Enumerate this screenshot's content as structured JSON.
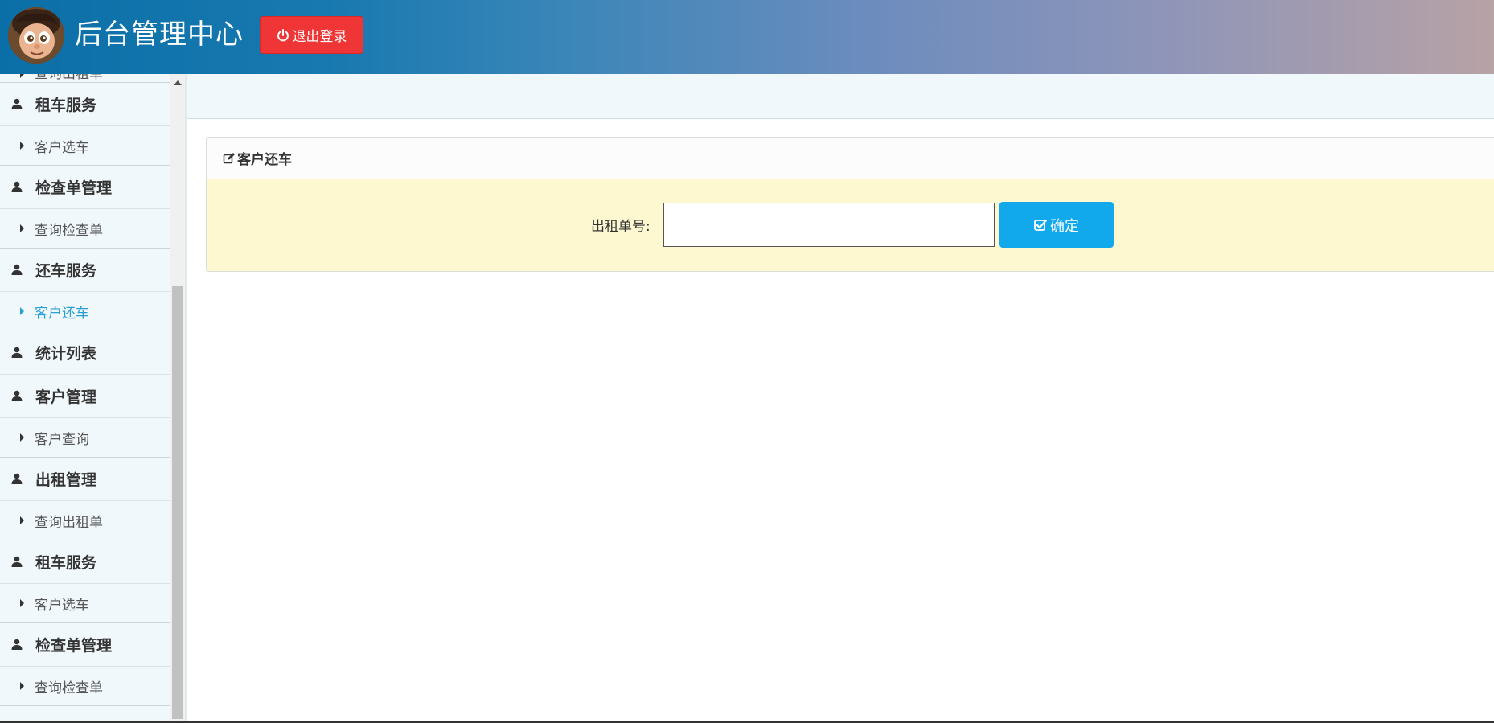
{
  "header": {
    "title": "后台管理中心",
    "logout_label": "退出登录",
    "logout_icon": "power-icon"
  },
  "sidebar": {
    "items": [
      {
        "type": "sub",
        "label": "查询出租单",
        "active": false
      },
      {
        "type": "head",
        "label": "租车服务"
      },
      {
        "type": "sub",
        "label": "客户选车",
        "active": false
      },
      {
        "type": "head",
        "label": "检查单管理"
      },
      {
        "type": "sub",
        "label": "查询检查单",
        "active": false
      },
      {
        "type": "head",
        "label": "还车服务"
      },
      {
        "type": "sub",
        "label": "客户还车",
        "active": true
      },
      {
        "type": "head",
        "label": "统计列表"
      },
      {
        "type": "head",
        "label": "客户管理"
      },
      {
        "type": "sub",
        "label": "客户查询",
        "active": false
      },
      {
        "type": "head",
        "label": "出租管理"
      },
      {
        "type": "sub",
        "label": "查询出租单",
        "active": false
      },
      {
        "type": "head",
        "label": "租车服务"
      },
      {
        "type": "sub",
        "label": "客户选车",
        "active": false
      },
      {
        "type": "head",
        "label": "检查单管理"
      },
      {
        "type": "sub",
        "label": "查询检查单",
        "active": false
      }
    ]
  },
  "panel": {
    "title": "客户还车",
    "field_label": "出租单号:",
    "input_value": "",
    "input_placeholder": "",
    "confirm_label": "确定"
  },
  "colors": {
    "accent": "#12a8ec",
    "danger": "#ef3535",
    "active_menu": "#2a9fd6",
    "panel_body_bg": "#fdf8d0"
  }
}
